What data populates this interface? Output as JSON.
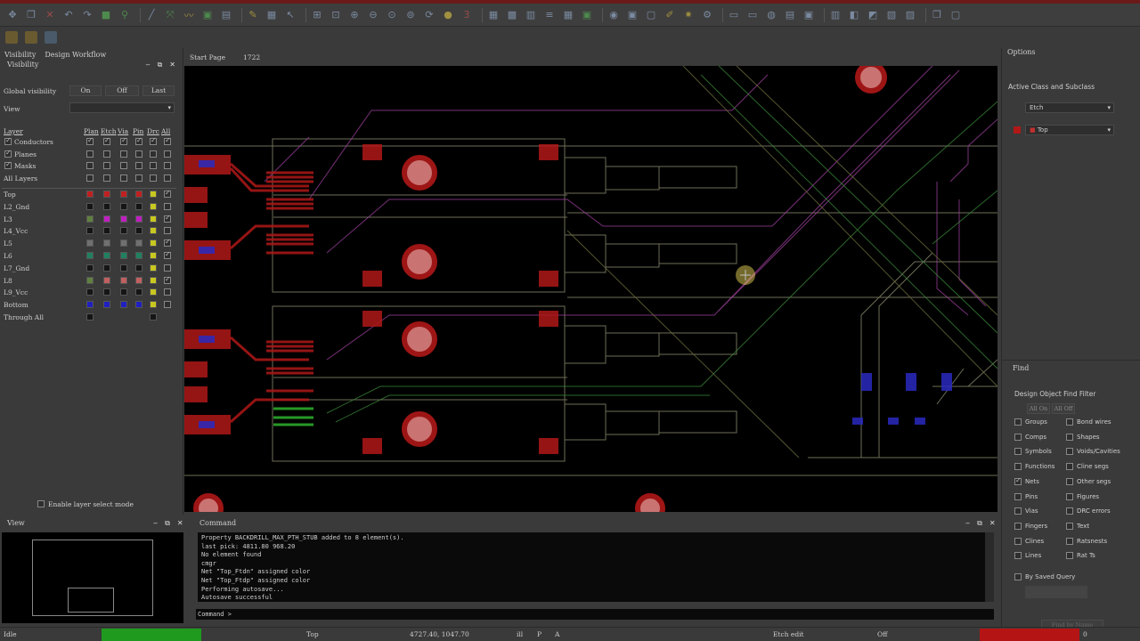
{
  "left_panel": {
    "tabs": [
      "Visibility",
      "Design Workflow"
    ],
    "title": "Visibility",
    "global_visibility_label": "Global visibility",
    "buttons": [
      "On",
      "Off",
      "Last"
    ],
    "view_label": "View",
    "view_value": "",
    "col_layer": "Layer",
    "col_headers": [
      "Plan",
      "Etch",
      "Via",
      "Pin",
      "Drc",
      "All"
    ],
    "groups": [
      {
        "label": "Conductors",
        "checks": [
          true,
          true,
          true,
          true,
          true,
          true
        ]
      },
      {
        "label": "Planes",
        "checks": [
          false,
          false,
          false,
          false,
          false,
          false
        ]
      },
      {
        "label": "Masks",
        "checks": [
          false,
          false,
          false,
          false,
          false,
          false
        ]
      },
      {
        "label": "All Layers",
        "checks": [
          false,
          false,
          false,
          false,
          false,
          false
        ]
      }
    ],
    "layers": [
      {
        "name": "Top",
        "colors": [
          "#c02020",
          "#c02020",
          "#c02020",
          "#c02020",
          "#c8c820"
        ],
        "all": true
      },
      {
        "name": "L2_Gnd",
        "colors": [
          "#151515",
          "#151515",
          "#151515",
          "#151515",
          "#c8c820"
        ],
        "all": false
      },
      {
        "name": "L3",
        "colors": [
          "#608040",
          "#c020c0",
          "#c020c0",
          "#c020c0",
          "#c8c820"
        ],
        "all": true
      },
      {
        "name": "L4_Vcc",
        "colors": [
          "#151515",
          "#151515",
          "#151515",
          "#151515",
          "#c8c820"
        ],
        "all": false
      },
      {
        "name": "L5",
        "colors": [
          "#707070",
          "#707070",
          "#707070",
          "#707070",
          "#c8c820"
        ],
        "all": true
      },
      {
        "name": "L6",
        "colors": [
          "#208060",
          "#208060",
          "#208060",
          "#208060",
          "#c8c820"
        ],
        "all": true
      },
      {
        "name": "L7_Gnd",
        "colors": [
          "#151515",
          "#151515",
          "#151515",
          "#151515",
          "#c8c820"
        ],
        "all": false
      },
      {
        "name": "L8",
        "colors": [
          "#608040",
          "#c06060",
          "#c06060",
          "#c06060",
          "#c8c820"
        ],
        "all": true
      },
      {
        "name": "L9_Vcc",
        "colors": [
          "#151515",
          "#151515",
          "#151515",
          "#151515",
          "#c8c820"
        ],
        "all": false
      },
      {
        "name": "Bottom",
        "colors": [
          "#2020c0",
          "#2020c0",
          "#2020c0",
          "#2020c0",
          "#c8c820"
        ],
        "all": false
      },
      {
        "name": "Through All",
        "colors": [
          "#151515",
          null,
          null,
          null,
          "#151515"
        ],
        "all": false
      }
    ],
    "enable_layer_select": "Enable layer select mode"
  },
  "doc_tabs": [
    "Start Page",
    "1722"
  ],
  "right_panel": {
    "options_title": "Options",
    "active_class_label": "Active Class and Subclass",
    "class_value": "Etch",
    "subclass_value": "Top",
    "find_title": "Find",
    "find_filter_label": "Design Object Find Filter",
    "all_on": "All On",
    "all_off": "All Off",
    "find_left": [
      {
        "label": "Groups",
        "checked": false
      },
      {
        "label": "Comps",
        "checked": false
      },
      {
        "label": "Symbols",
        "checked": false
      },
      {
        "label": "Functions",
        "checked": false
      },
      {
        "label": "Nets",
        "checked": true
      },
      {
        "label": "Pins",
        "checked": false
      },
      {
        "label": "Vias",
        "checked": false
      },
      {
        "label": "Fingers",
        "checked": false
      },
      {
        "label": "Clines",
        "checked": false
      },
      {
        "label": "Lines",
        "checked": false
      }
    ],
    "find_right": [
      {
        "label": "Bond wires",
        "checked": false
      },
      {
        "label": "Shapes",
        "checked": false
      },
      {
        "label": "Voids/Cavities",
        "checked": false
      },
      {
        "label": "Cline segs",
        "checked": false
      },
      {
        "label": "Other segs",
        "checked": false
      },
      {
        "label": "Figures",
        "checked": false
      },
      {
        "label": "DRC errors",
        "checked": false
      },
      {
        "label": "Text",
        "checked": false
      },
      {
        "label": "Ratsnests",
        "checked": false
      },
      {
        "label": "Rat Ts",
        "checked": false
      }
    ],
    "by_saved_query": "By Saved Query",
    "find_by_name": "Find by Name"
  },
  "view_panel": {
    "title": "View"
  },
  "command_panel": {
    "title": "Command",
    "lines": [
      "Property BACKDRILL_MAX_PTH_STUB added to 8 element(s).",
      "last pick:  4811.80 968.20",
      "No element found",
      "cmgr",
      "Net \"Top_Ftdn\" assigned color",
      "Net \"Top_Ftdp\" assigned color",
      "Performing autosave...",
      "Autosave successful"
    ],
    "prompt": "Command >"
  },
  "status": {
    "state": "Idle",
    "layer": "Top",
    "coords": "4727.40, 1047.70",
    "mode1": "ill",
    "mode2": "P",
    "mode3": "A",
    "edit_mode": "Etch edit",
    "drc": "Off",
    "errors": "0",
    "colors": {
      "green": "#1f9a1f",
      "red": "#b51414"
    }
  }
}
